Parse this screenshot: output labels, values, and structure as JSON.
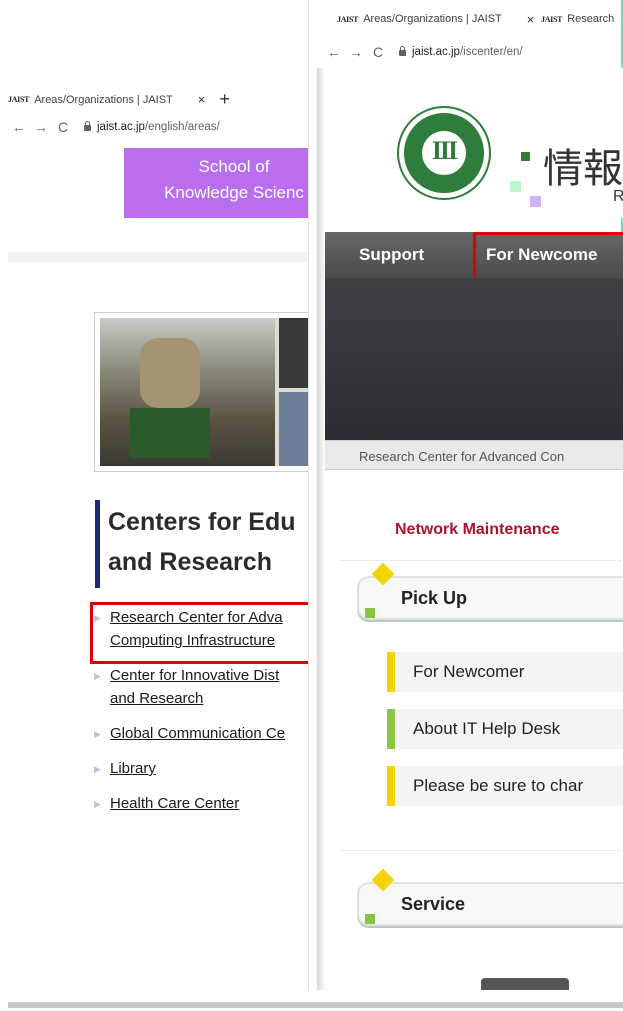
{
  "back_window": {
    "tab": {
      "favicon": "JAIST",
      "title": "Areas/Organizations | JAIST",
      "close": "×",
      "new_tab": "+"
    },
    "address": {
      "back": "←",
      "forward": "→",
      "reload": "C",
      "host": "jaist.ac.jp",
      "path": "/english/areas/"
    },
    "school_box": {
      "line1": "School of",
      "line2": "Knowledge Scienc"
    },
    "heading": {
      "line1": "Centers for Edu",
      "line2": "and Research"
    },
    "links": [
      {
        "line1": "Research Center for Adva",
        "line2": "Computing Infrastructure"
      },
      {
        "line1": "Center for Innovative Dist",
        "line2": "and Research"
      },
      {
        "line1": "Global Communication Ce",
        "line2": ""
      },
      {
        "line1": "Library",
        "line2": ""
      },
      {
        "line1": "Health Care Center",
        "line2": ""
      }
    ]
  },
  "front_window": {
    "tab1": {
      "favicon": "JAIST",
      "title": "Areas/Organizations | JAIST",
      "close": "×"
    },
    "tab2": {
      "favicon": "JAIST",
      "title": "Research"
    },
    "address": {
      "back": "←",
      "forward": "→",
      "reload": "C",
      "host": "jaist.ac.jp",
      "path": "/iscenter/en/"
    },
    "logo": {
      "kanji": "情報",
      "sub": "R"
    },
    "nav": {
      "support": "Support",
      "newcomer": "For Newcome"
    },
    "breadcrumb": "Research Center for Advanced Con",
    "notice": "Network Maintenance",
    "pickup": {
      "title": "Pick Up",
      "items": [
        "For Newcomer",
        "About IT Help Desk",
        "Please be sure to char"
      ]
    },
    "service": {
      "title": "Service"
    }
  },
  "colors": {
    "highlight": "#e00000",
    "school_box": "#b96ef0",
    "heading_bar": "#1d2a6e",
    "notice": "#b0122c",
    "accent_yellow": "#f4d400",
    "accent_green": "#8cc63f",
    "logo_green": "#2e7d3a"
  }
}
